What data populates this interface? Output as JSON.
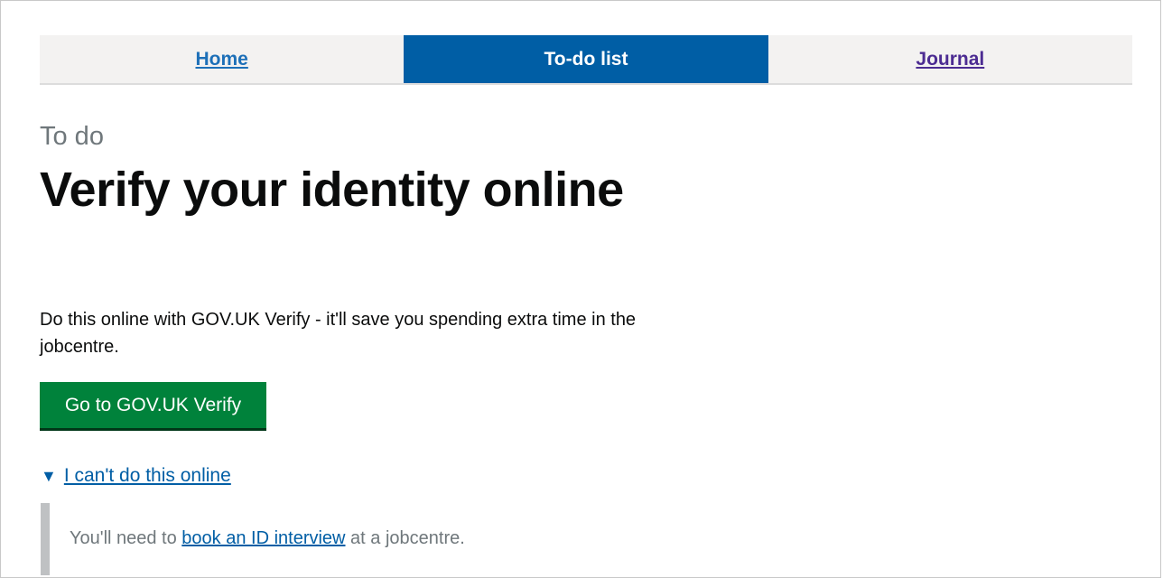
{
  "nav": {
    "items": [
      {
        "label": "Home",
        "state": "link"
      },
      {
        "label": "To-do list",
        "state": "active"
      },
      {
        "label": "Journal",
        "state": "visited"
      }
    ]
  },
  "page": {
    "caption": "To do",
    "title": "Verify your identity online",
    "intro": "Do this online with GOV.UK Verify - it'll save you spending extra time in the jobcentre.",
    "primary_button": "Go to GOV.UK Verify"
  },
  "details": {
    "arrow": "▼",
    "summary": "I can't do this online",
    "text_before": "You'll need to ",
    "link": "book an ID interview",
    "text_after": " at a jobcentre."
  },
  "colors": {
    "nav_active": "#005ea5",
    "button": "#00823b",
    "link": "#005ea5",
    "visited_link": "#4c2c92"
  }
}
